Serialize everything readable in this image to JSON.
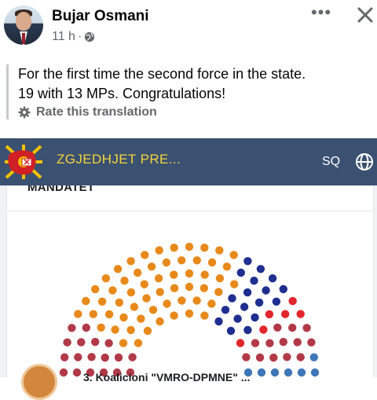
{
  "post": {
    "author": "Bujar Osmani",
    "time": "11 h",
    "separator": "·",
    "more_label": "•••",
    "text_line1": "For the first time the second force in the state.",
    "text_line2": "19 with 13 MPs. Congratulations!",
    "rate_label": "Rate this translation"
  },
  "shared_page": {
    "title": "ZGJEDHJET PRE...",
    "language": "SQ",
    "heading": "MANDATET",
    "party_name": "3. Koalicioni \"VMRO-DPMNE\" ..."
  },
  "colors": {
    "header_bar": "#3b5171",
    "title_yellow": "#f6d33c",
    "orange_seats": "#e8891c",
    "navy_seats": "#1f2f8f",
    "red_seats": "#e3262c",
    "dark_red_seats": "#b23a48",
    "steel_blue_seats": "#3e77b8"
  },
  "icons": {
    "globe": "globe-icon",
    "gear": "gear-icon",
    "close": "close-icon",
    "more": "more-dots-icon"
  },
  "chart_data": {
    "type": "parliament",
    "total_seats": 120,
    "series": [
      {
        "name": "",
        "color": "#b23a48",
        "seats": 18
      },
      {
        "name": "",
        "color": "#e8891c",
        "seats": 58
      },
      {
        "name": "",
        "color": "#1f2f8f",
        "seats": 18
      },
      {
        "name": "",
        "color": "#e3262c",
        "seats": 6
      },
      {
        "name": "",
        "color": "#b23a48",
        "seats": 13
      },
      {
        "name": "",
        "color": "#3e77b8",
        "seats": 7
      }
    ]
  }
}
